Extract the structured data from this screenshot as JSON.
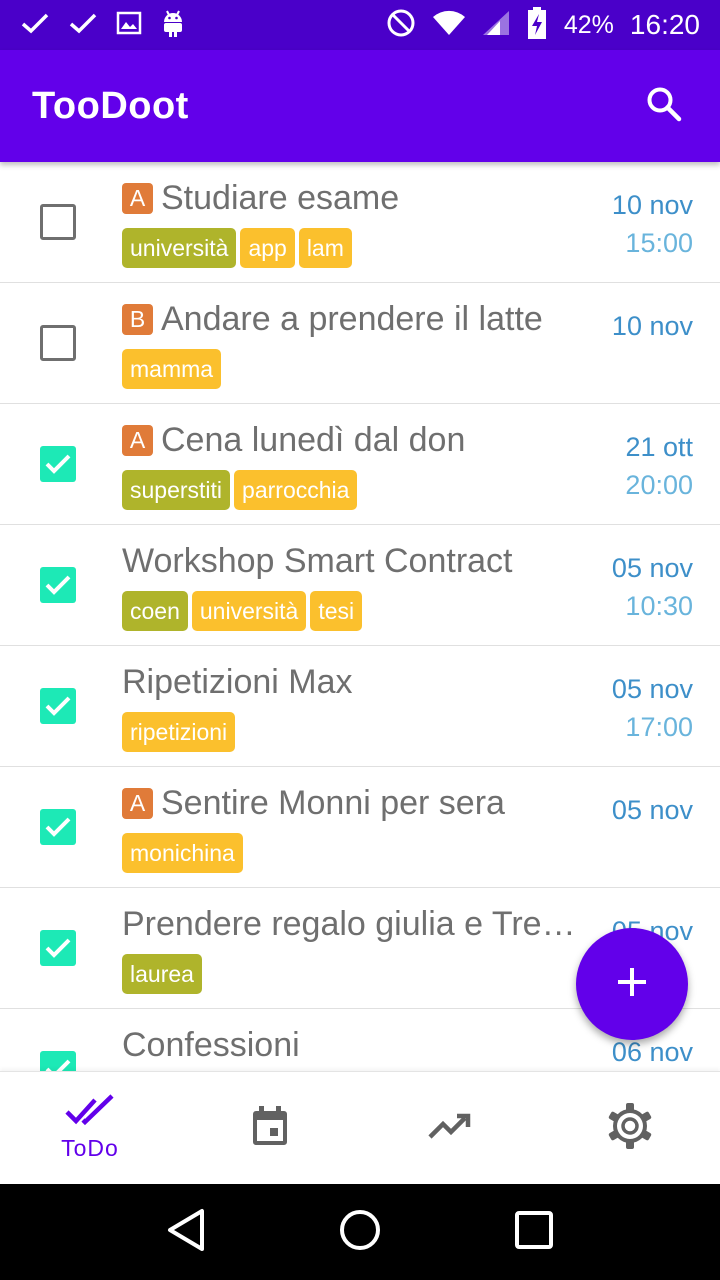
{
  "status_bar": {
    "icons_left": [
      "check-icon",
      "check-icon",
      "image-icon",
      "android-icon"
    ],
    "icons_right": [
      "do-not-disturb-icon",
      "wifi-icon",
      "signal-icon",
      "battery-charging-icon"
    ],
    "battery": "42%",
    "time": "16:20"
  },
  "app_bar": {
    "title": "TooDoot",
    "search_icon": "search-icon"
  },
  "tasks": [
    {
      "checked": false,
      "priority": "A",
      "title": "Studiare esame",
      "tags": [
        {
          "label": "università",
          "color": "olive"
        },
        {
          "label": "app",
          "color": "yellow"
        },
        {
          "label": "lam",
          "color": "yellow"
        }
      ],
      "date": "10 nov",
      "time": "15:00"
    },
    {
      "checked": false,
      "priority": "B",
      "title": "Andare a prendere il latte",
      "tags": [
        {
          "label": "mamma",
          "color": "yellow"
        }
      ],
      "date": "10 nov",
      "time": ""
    },
    {
      "checked": true,
      "priority": "A",
      "title": "Cena lunedì dal don",
      "tags": [
        {
          "label": "superstiti",
          "color": "olive"
        },
        {
          "label": "parrocchia",
          "color": "yellow"
        }
      ],
      "date": "21 ott",
      "time": "20:00"
    },
    {
      "checked": true,
      "priority": "",
      "title": "Workshop Smart Contract",
      "tags": [
        {
          "label": "coen",
          "color": "olive"
        },
        {
          "label": "università",
          "color": "yellow"
        },
        {
          "label": "tesi",
          "color": "yellow"
        }
      ],
      "date": "05 nov",
      "time": "10:30"
    },
    {
      "checked": true,
      "priority": "",
      "title": "Ripetizioni Max",
      "tags": [
        {
          "label": "ripetizioni",
          "color": "yellow"
        }
      ],
      "date": "05 nov",
      "time": "17:00"
    },
    {
      "checked": true,
      "priority": "A",
      "title": "Sentire Monni per sera",
      "tags": [
        {
          "label": "monichina",
          "color": "yellow"
        }
      ],
      "date": "05 nov",
      "time": ""
    },
    {
      "checked": true,
      "priority": "",
      "title": "Prendere regalo giulia e Tre…",
      "tags": [
        {
          "label": "laurea",
          "color": "olive"
        }
      ],
      "date": "05 nov",
      "time": ""
    },
    {
      "checked": true,
      "priority": "",
      "title": "Confessioni",
      "tags": [],
      "date": "06 nov",
      "time": ""
    }
  ],
  "fab": {
    "icon": "add-icon"
  },
  "bottom_nav": {
    "items": [
      {
        "icon": "done-all-icon",
        "label": "ToDo",
        "active": true
      },
      {
        "icon": "calendar-icon",
        "label": "",
        "active": false
      },
      {
        "icon": "trending-up-icon",
        "label": "",
        "active": false
      },
      {
        "icon": "settings-gear-icon",
        "label": "",
        "active": false
      }
    ]
  },
  "colors": {
    "primary": "#6200ea",
    "status_bar": "#4a00c9",
    "checkbox_checked": "#1de9b6",
    "priority_badge": "#e07b39",
    "tag_olive": "#afb42b",
    "tag_yellow": "#fbc02d",
    "date_text": "#3d8fc9"
  }
}
